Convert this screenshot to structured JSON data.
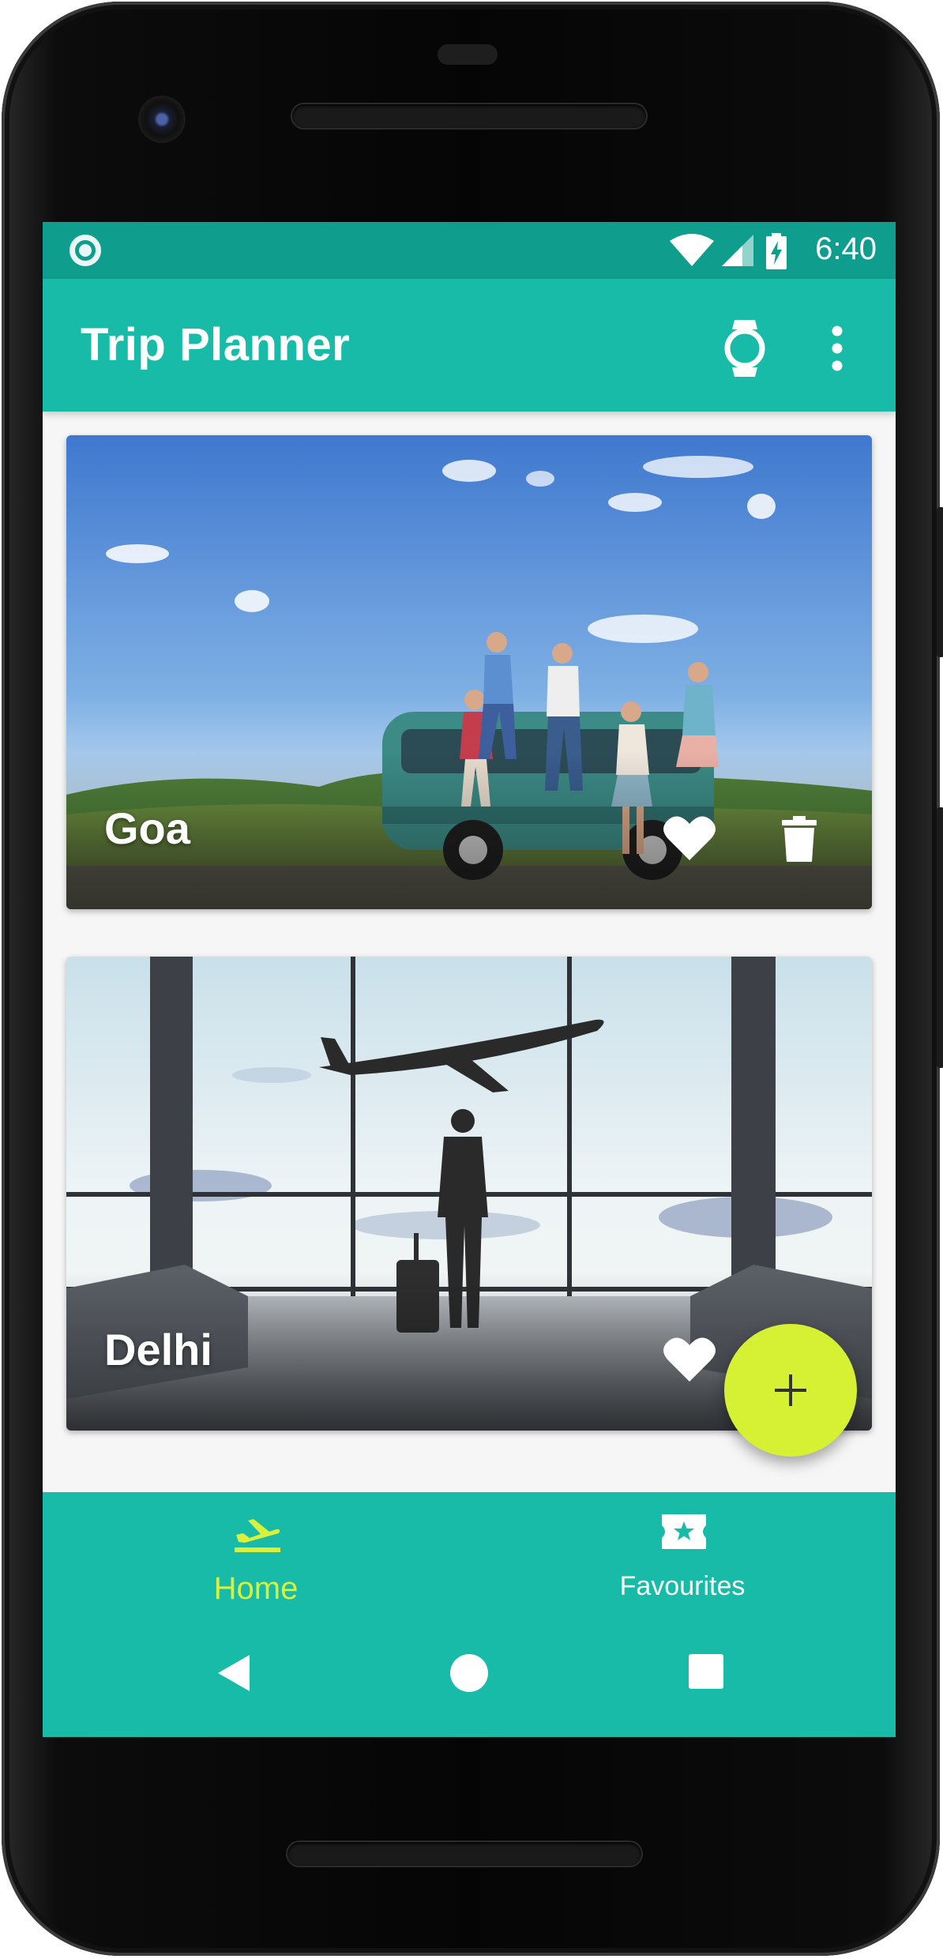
{
  "status_bar": {
    "time": "6:40",
    "icons": [
      "notification-dot-icon",
      "wifi-icon",
      "signal-icon",
      "battery-charging-icon"
    ]
  },
  "app_bar": {
    "title": "Trip Planner",
    "actions": [
      "watch-icon",
      "more-vert-icon"
    ]
  },
  "trips": [
    {
      "title": "Goa",
      "favourite_icon": "heart-icon",
      "delete_icon": "delete-icon"
    },
    {
      "title": "Delhi",
      "favourite_icon": "heart-icon"
    }
  ],
  "fab": {
    "icon": "plus-icon"
  },
  "bottom_nav": {
    "items": [
      {
        "label": "Home",
        "icon": "flight-takeoff-icon",
        "active": true
      },
      {
        "label": "Favourites",
        "icon": "ticket-star-icon",
        "active": false
      }
    ]
  },
  "system_nav": [
    "back-icon",
    "home-circle-icon",
    "recents-icon"
  ],
  "colors": {
    "primary": "#17bba7",
    "primary_dark": "#0f9e8d",
    "accent": "#d6f033",
    "active_nav": "#d9f13a",
    "background": "#f6f6f6"
  }
}
